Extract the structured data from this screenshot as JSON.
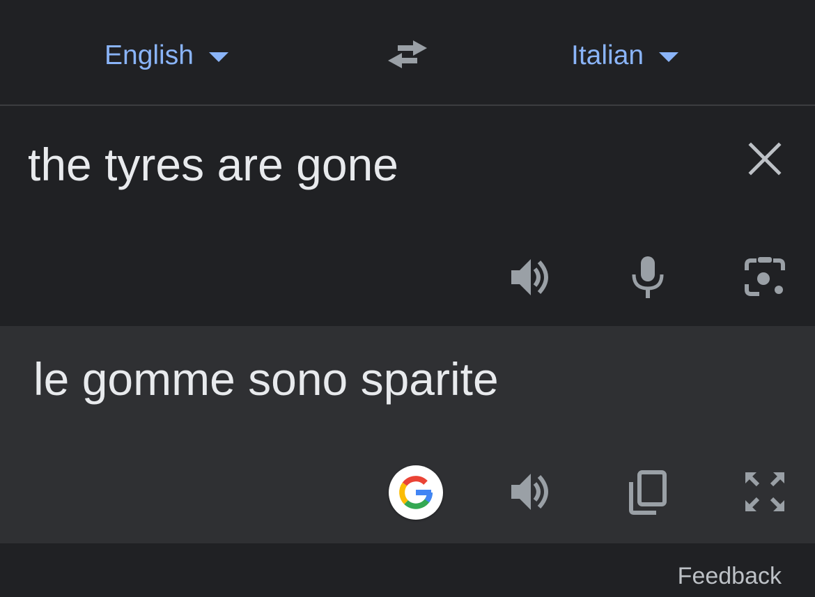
{
  "language_bar": {
    "source_language": "English",
    "target_language": "Italian",
    "swap_icon": "swap-arrows-icon"
  },
  "source": {
    "text": "the tyres are gone",
    "icons": [
      "close-icon",
      "speaker-icon",
      "microphone-icon",
      "camera-lens-icon"
    ]
  },
  "result": {
    "text": "le gomme sono sparite",
    "icons": [
      "google-logo-icon",
      "speaker-icon",
      "copy-icon",
      "fullscreen-expand-icon"
    ]
  },
  "footer": {
    "feedback_label": "Feedback"
  },
  "colors": {
    "background": "#202124",
    "result_background": "#2f3033",
    "accent": "#8ab4f8",
    "text": "#e8eaed",
    "icon": "#9aa0a6"
  }
}
